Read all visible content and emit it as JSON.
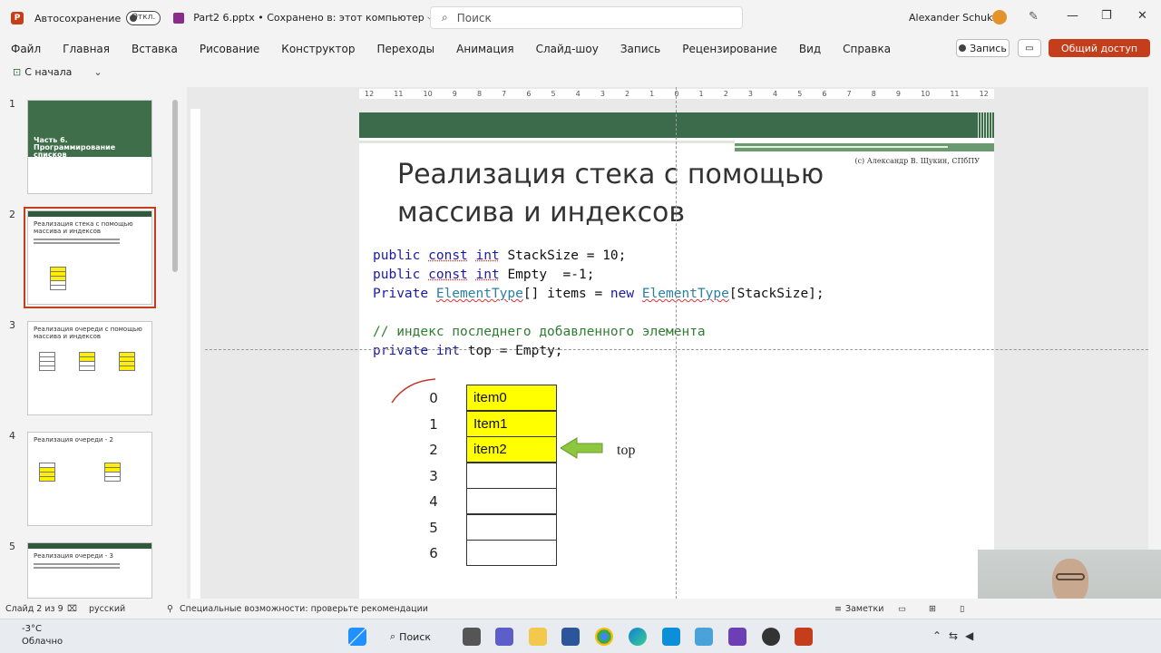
{
  "titlebar": {
    "autosave_label": "Автосохранение",
    "autosave_state": "Откл.",
    "document_title": "Part2 6.pptx • Сохранено в: этот компьютер ⌵",
    "search_placeholder": "Поиск",
    "user_name": "Alexander Schukin"
  },
  "menu": {
    "items": [
      "Файл",
      "Главная",
      "Вставка",
      "Рисование",
      "Конструктор",
      "Переходы",
      "Анимация",
      "Слайд-шоу",
      "Запись",
      "Рецензирование",
      "Вид",
      "Справка"
    ],
    "record_label": "Запись",
    "share_label": "Общий доступ"
  },
  "qat": {
    "start_label": "С начала"
  },
  "thumbnails": [
    {
      "number": "1",
      "title": "Часть 6. Программирование списков"
    },
    {
      "number": "2",
      "title": "Реализация стека с помощью массива и индексов"
    },
    {
      "number": "3",
      "title": "Реализация очереди с помощью массива и индексов"
    },
    {
      "number": "4",
      "title": "Реализация очереди - 2"
    },
    {
      "number": "5",
      "title": "Реализация очереди - 3"
    }
  ],
  "ruler": [
    "12",
    "11",
    "10",
    "9",
    "8",
    "7",
    "6",
    "5",
    "4",
    "3",
    "2",
    "1",
    "0",
    "1",
    "2",
    "3",
    "4",
    "5",
    "6",
    "7",
    "8",
    "9",
    "10",
    "11",
    "12"
  ],
  "slide": {
    "copyright": "(c) Александр В. Щукин, СПбПУ",
    "title": "Реализация стека с помощью массива и индексов",
    "code": {
      "l1_kw1": "public",
      "l1_kw2": "const",
      "l1_kw3": "int",
      "l1_rest": " StackSize = 10;",
      "l2_kw1": "public",
      "l2_kw2": "const",
      "l2_kw3": "int",
      "l2_rest": " Empty  =-1;",
      "l3_kw1": "Private",
      "l3_ty1": "ElementType",
      "l3_mid": "[] items = ",
      "l3_kw2": "new",
      "l3_ty2": "ElementType",
      "l3_rest": "[StackSize];",
      "comment": "// индекс последнего добавленного элемента",
      "l5_kw1": "private",
      "l5_kw2": "int",
      "l5_rest": " top = Empty;"
    },
    "indices": [
      "0",
      "1",
      "2",
      "3",
      "4",
      "5",
      "6"
    ],
    "cells": [
      "item0",
      "Item1",
      "item2",
      "",
      "",
      "",
      ""
    ],
    "filled_count": 3,
    "pointer_label": "top",
    "pointer_index": 2
  },
  "colors": {
    "accent": "#c43e1c",
    "slide_band": "#3b6b4a",
    "cell_fill": "#ffff00",
    "arrow_fill": "#8dc63f"
  },
  "statusbar": {
    "slide_counter": "Слайд 2 из 9",
    "language": "русский",
    "accessibility": "Специальные возможности: проверьте рекомендации",
    "notes_label": "Заметки"
  },
  "taskbar": {
    "temperature": "-3°C",
    "weather": "Облачно",
    "search_label": "Поиск"
  },
  "icons": {
    "start": "windows-start-icon",
    "search": "magnifier-icon",
    "minimize": "minimize-icon",
    "maximize": "maximize-icon",
    "close": "close-icon"
  }
}
